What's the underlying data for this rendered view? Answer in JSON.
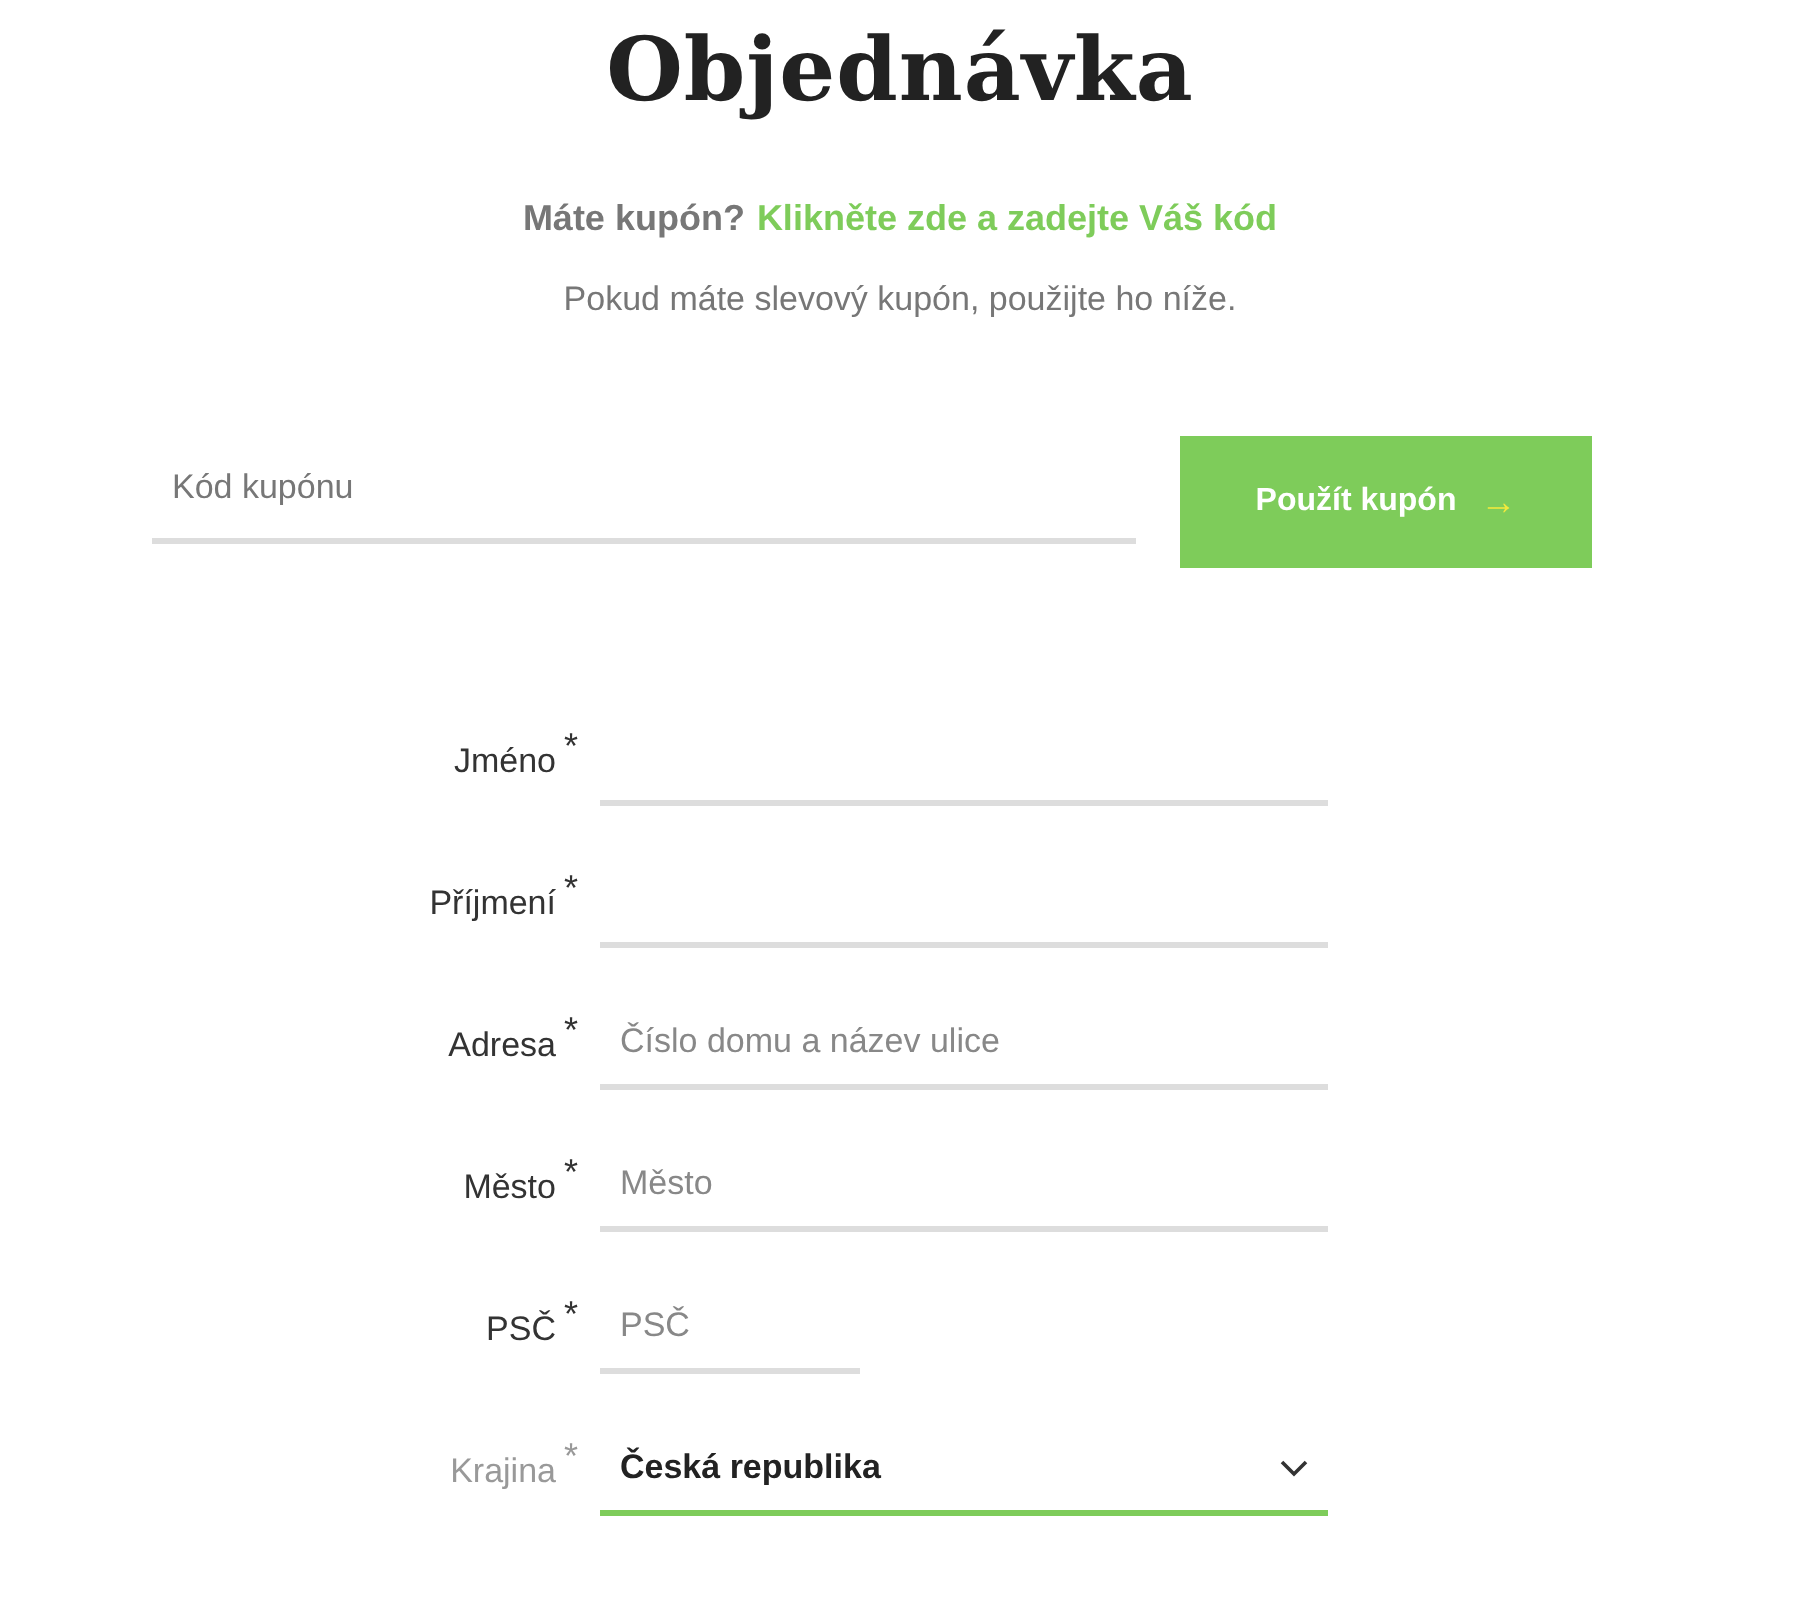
{
  "title": "Objednávka",
  "coupon_prompt": {
    "text": "Máte kupón?",
    "link": "Klikněte zde a zadejte Váš kód"
  },
  "coupon_note": "Pokud máte slevový kupón, použijte ho níže.",
  "coupon": {
    "placeholder": "Kód kupónu",
    "button": "Použít kupón",
    "button_icon": "→"
  },
  "fields": [
    {
      "kind": "text",
      "label": "Jméno",
      "required_mark": "*",
      "focused": false
    },
    {
      "kind": "text",
      "label": "Příjmení",
      "required_mark": "*",
      "focused": false
    },
    {
      "kind": "text",
      "label": "Adresa",
      "required_mark": "*",
      "placeholder": "Číslo domu a název ulice",
      "focused": false
    },
    {
      "kind": "text",
      "label": "Město",
      "required_mark": "*",
      "placeholder": "Město",
      "focused": false
    },
    {
      "kind": "short",
      "label": "PSČ",
      "required_mark": "*",
      "placeholder": "PSČ",
      "focused": false
    },
    {
      "kind": "select",
      "label": "Krajina",
      "required_mark": "*",
      "value": "Česká republika",
      "focused": true
    }
  ]
}
